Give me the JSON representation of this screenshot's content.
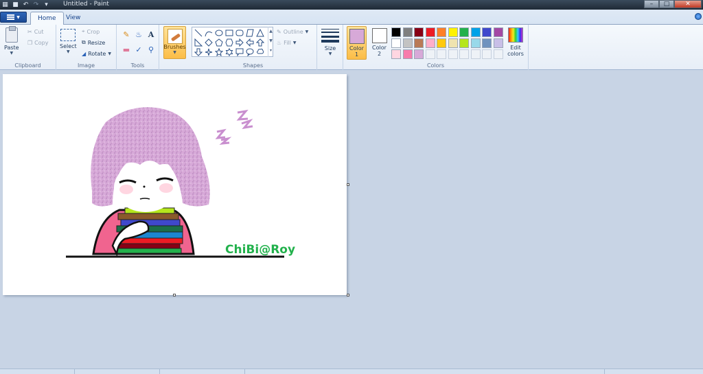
{
  "window": {
    "title": "Untitled - Paint"
  },
  "tabs": [
    {
      "label": "Home"
    },
    {
      "label": "View"
    }
  ],
  "clipboard": {
    "paste_label": "Paste",
    "cut_label": "Cut",
    "copy_label": "Copy",
    "group_label": "Clipboard"
  },
  "image": {
    "select_label": "Select",
    "crop_label": "Crop",
    "resize_label": "Resize",
    "rotate_label": "Rotate",
    "group_label": "Image"
  },
  "tools": {
    "group_label": "Tools",
    "icons": [
      "pencil-icon",
      "fill-icon",
      "text-icon",
      "eraser-icon",
      "color-picker-icon",
      "magnifier-icon"
    ]
  },
  "brushes": {
    "label": "Brushes"
  },
  "shapes": {
    "outline_label": "Outline",
    "fill_label": "Fill",
    "group_label": "Shapes"
  },
  "size": {
    "label": "Size"
  },
  "colors": {
    "color1_label": "Color 1",
    "color1_line1": "Color",
    "color1_line2": "1",
    "color2_line1": "Color",
    "color2_line2": "2",
    "color1_value": "#d7a9d8",
    "color2_value": "#ffffff",
    "edit_line1": "Edit",
    "edit_line2": "colors",
    "group_label": "Colors",
    "palette_row1": [
      "#000000",
      "#7f7f7f",
      "#880015",
      "#ed1c24",
      "#ff7f27",
      "#fff200",
      "#22b14c",
      "#00a2e8",
      "#3f48cc",
      "#a349a4"
    ],
    "palette_row2": [
      "#ffffff",
      "#c3c3c3",
      "#b97a57",
      "#ffaec9",
      "#ffc90e",
      "#efe4b0",
      "#b5e61d",
      "#99d9ea",
      "#7092be",
      "#c8bfe7"
    ],
    "palette_row3": [
      "#ffd6e1",
      "#f77cac",
      "#d7a9d8",
      "",
      "",
      "",
      "",
      "",
      "",
      ""
    ]
  },
  "drawing": {
    "signature": "ChiBi@Roy",
    "signature_color": "#22b14c",
    "hair_color": "#d7a9d8"
  }
}
